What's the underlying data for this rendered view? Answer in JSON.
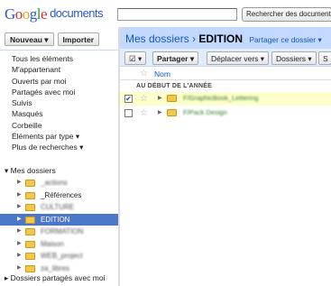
{
  "header": {
    "logo_google": "Google",
    "logo_product": "documents",
    "search_value": "",
    "search_button": "Rechercher des documents"
  },
  "left": {
    "new_button": "Nouveau ▾",
    "import_button": "Importer",
    "nav": [
      "Tous les éléments",
      "M'appartenant",
      "Ouverts par moi",
      "Partagés avec moi",
      "Suivis",
      "Masqués",
      "Corbeille",
      "Éléments par type ▾",
      "Plus de recherches ▾"
    ],
    "my_folders": "▾ Mes dossiers",
    "folders": [
      {
        "name": "_actions",
        "blurred": true,
        "selected": false
      },
      {
        "name": "_Références",
        "blurred": false,
        "selected": false
      },
      {
        "name": "CULTURE",
        "blurred": true,
        "selected": false
      },
      {
        "name": "EDITION",
        "blurred": false,
        "selected": true
      },
      {
        "name": "FORMATION",
        "blurred": true,
        "selected": false
      },
      {
        "name": "Maison",
        "blurred": true,
        "selected": false
      },
      {
        "name": "WEB_project",
        "blurred": true,
        "selected": false
      },
      {
        "name": "za_libres",
        "blurred": true,
        "selected": false
      }
    ],
    "shared_folders": "▸ Dossiers partagés avec moi"
  },
  "main": {
    "breadcrumb_root": "Mes dossiers",
    "breadcrumb_sep": "›",
    "breadcrumb_current": "EDITION",
    "share_link": "Partager ce dossier ▾",
    "toolbar": {
      "select": "☑ ▾",
      "share": "Partager ▾",
      "move": "Déplacer vers ▾",
      "folders": "Dossiers ▾",
      "more": "S"
    },
    "col_name": "Nom",
    "group_label": "AU DÉBUT DE L'ANNÉE",
    "rows": [
      {
        "name": "F/GraphicBook_Lettering",
        "checked": true,
        "highlight": true
      },
      {
        "name": "F/Pack Design",
        "checked": false,
        "highlight": false
      }
    ]
  },
  "colors": {
    "accent": "#4c76c9",
    "header_bg": "#c3d9ff",
    "toolbar_bg": "#e0ecff",
    "link": "#1155cc",
    "row_highlight": "#ffffcc"
  }
}
